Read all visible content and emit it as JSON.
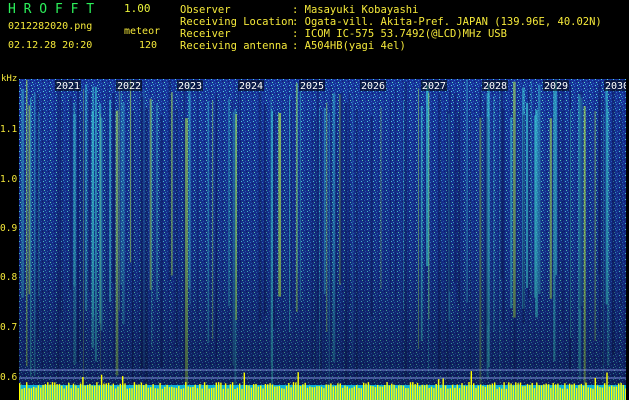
{
  "header": {
    "app_title": "H R O F F T",
    "version": "1.00",
    "filename": "0212282020.png",
    "meteor_label": "meteor",
    "datetime": "02.12.28 20:20",
    "meteor_count": "120"
  },
  "info": [
    {
      "key": "Observer",
      "value": ": Masayuki Kobayashi"
    },
    {
      "key": "Receiving Location",
      "value": ": Ogata-vill. Akita-Pref. JAPAN (139.96E, 40.02N)"
    },
    {
      "key": "Receiver",
      "value": ": ICOM IC-575 53.7492(@LCD)MHz USB"
    },
    {
      "key": "Receiving antenna",
      "value": ": A504HB(yagi 4el)"
    }
  ],
  "axis": {
    "unit": "kHz",
    "y_ticks": [
      "1.1",
      "1.0",
      "0.9",
      "0.8",
      "0.7",
      "0.6"
    ],
    "years": [
      "2021",
      "2022",
      "2023",
      "2024",
      "2025",
      "2026",
      "2027",
      "2028",
      "2029",
      "2030"
    ]
  },
  "colors": {
    "background": "#000000",
    "text": "#f5e93a",
    "title": "#2cf05a",
    "spectrum_base": "#1a3aa8",
    "spectrum_noise": "#4fd0e0",
    "spectrum_hot": "#c8f040",
    "baseline": "#ffff00"
  }
}
